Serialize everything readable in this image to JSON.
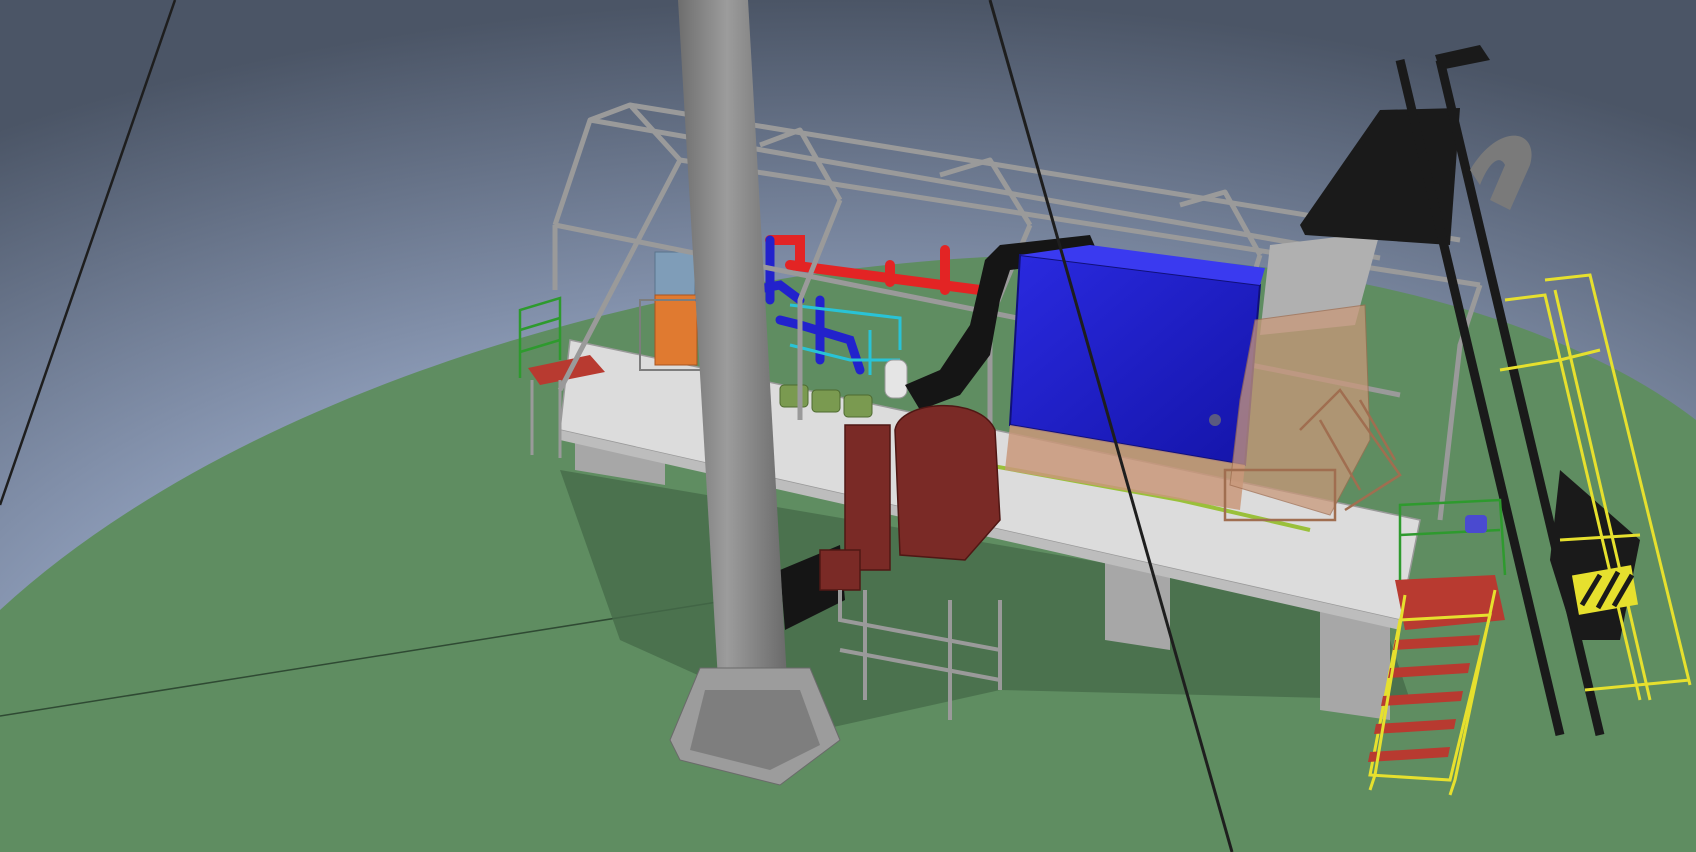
{
  "viewport": {
    "kind": "3d-cad-viewport",
    "background_colors": {
      "sky_dark": "#4b5566",
      "sky_mid": "#8d9cb8",
      "sky_light": "#c4ccda",
      "ground": "#5f8d61",
      "ground_shadow": "#466b4a"
    }
  },
  "model": {
    "structure_color": "#9a9a9a",
    "platform_color": "#dcdcdc",
    "chimney_color": "#8a8a8a",
    "boiler_color": "#1c1ccc",
    "duct_color": "#151515",
    "fan_color": "#7a2a26",
    "hot_pipe_color": "#e32424",
    "cold_pipe_color": "#2222cc",
    "water_pipe_color": "#29c3d6",
    "pump_color": "#7a9a50",
    "hopper_color": "#c9987a",
    "stair_color": "#e6e02e",
    "walkway_color": "#b83a30",
    "rail_color": "#2e9a2e",
    "hx_color": "#e07a30",
    "hx_panel_color": "#7f9db8"
  }
}
